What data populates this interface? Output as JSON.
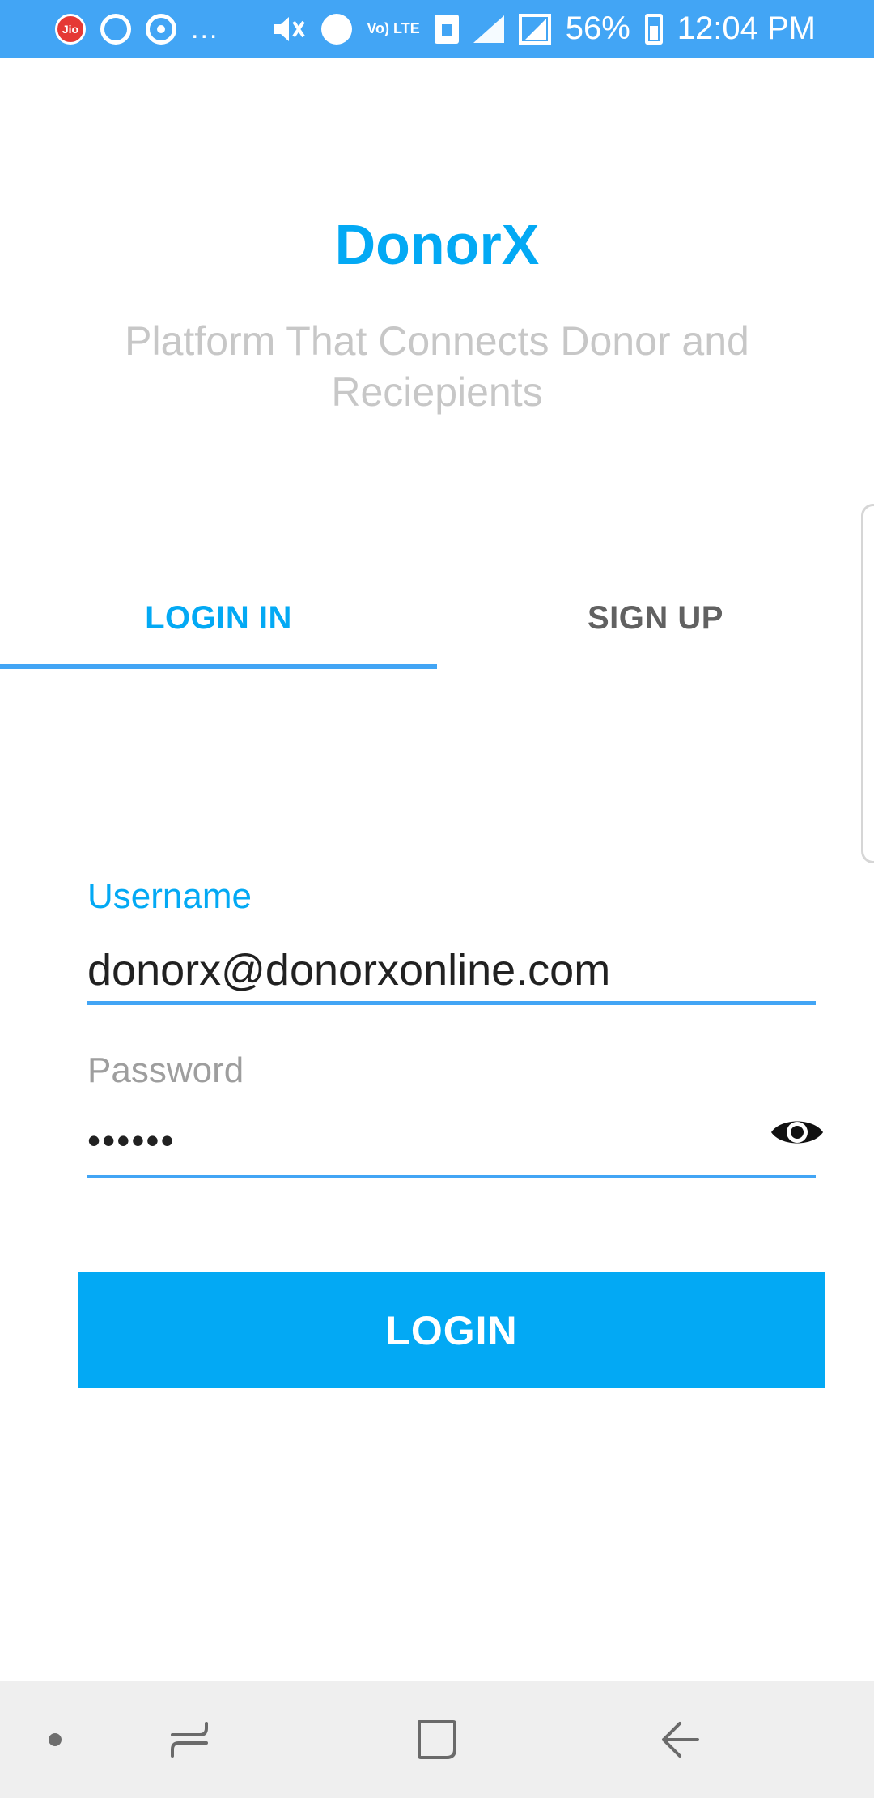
{
  "status_bar": {
    "carrier_icon": "jio-icon",
    "overflow": "...",
    "lte_indicator": "Vo) LTE",
    "battery_percent": "56%",
    "time": "12:04 PM",
    "background_color": "#42a5f5"
  },
  "header": {
    "title": "DonorX",
    "tagline": "Platform That Connects Donor and Reciepients",
    "accent_color": "#03a9f4"
  },
  "tabs": [
    {
      "label": "LOGIN IN",
      "active": true
    },
    {
      "label": "SIGN UP",
      "active": false
    }
  ],
  "form": {
    "username": {
      "label": "Username",
      "value": "donorx@donorxonline.com"
    },
    "password": {
      "label": "Password",
      "value": "••••••",
      "toggle_icon": "eye-icon"
    }
  },
  "login_button": {
    "label": "LOGIN",
    "color": "#03a9f4"
  },
  "nav_bar": {
    "items": [
      "dot-indicator",
      "recent-apps-icon",
      "home-icon",
      "back-icon"
    ]
  }
}
